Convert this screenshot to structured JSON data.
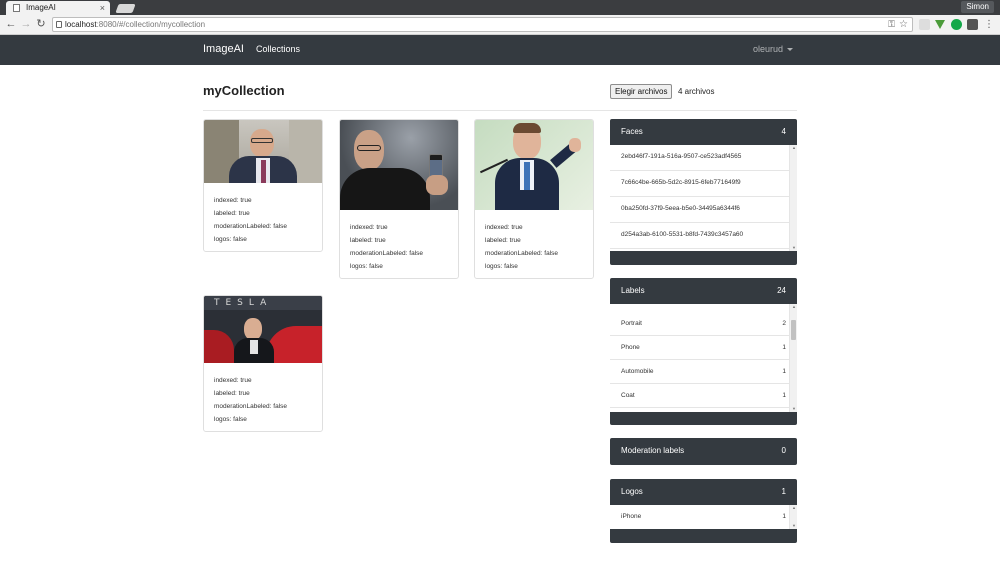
{
  "browser": {
    "tab_title": "ImageAI",
    "tab_close": "×",
    "profile": "Simon",
    "url_host": "localhost",
    "url_path": ":8080/#/collection/mycollection",
    "back": "←",
    "forward": "→",
    "reload": "↻",
    "key_glyph": "⚿",
    "star_glyph": "☆",
    "menu_glyph": "⋮"
  },
  "navbar": {
    "brand": "ImageAI",
    "collections": "Collections",
    "user": "oleurud"
  },
  "page": {
    "title": "myCollection",
    "file_button": "Elegir archivos",
    "file_status": "4 archivos"
  },
  "cards": [
    {
      "indexed": "indexed: true",
      "labeled": "labeled: true",
      "moderation": "moderationLabeled: false",
      "logos": "logos: false"
    },
    {
      "indexed": "indexed: true",
      "labeled": "labeled: true",
      "moderation": "moderationLabeled: false",
      "logos": "logos: false"
    },
    {
      "indexed": "indexed: true",
      "labeled": "labeled: true",
      "moderation": "moderationLabeled: false",
      "logos": "logos: false"
    },
    {
      "indexed": "indexed: true",
      "labeled": "labeled: true",
      "moderation": "moderationLabeled: false",
      "logos": "logos: false",
      "watermark": "TESLA"
    }
  ],
  "faces": {
    "title": "Faces",
    "count": "4",
    "items": [
      "2ebd46f7-191a-516a-9507-ce523adf4565",
      "7c66c4be-665b-5d2c-8915-6feb771649f9",
      "0ba250fd-37f9-5eea-b5e0-34495a6344f6",
      "d254a3ab-6100-5531-b8fd-7439c3457a60"
    ]
  },
  "labels": {
    "title": "Labels",
    "count": "24",
    "items": [
      {
        "name": "Portrait",
        "count": "2"
      },
      {
        "name": "Phone",
        "count": "1"
      },
      {
        "name": "Automobile",
        "count": "1"
      },
      {
        "name": "Coat",
        "count": "1"
      }
    ]
  },
  "moderation": {
    "title": "Moderation labels",
    "count": "0"
  },
  "logos": {
    "title": "Logos",
    "count": "1",
    "items": [
      {
        "name": "iPhone",
        "count": "1"
      }
    ]
  },
  "colors": {
    "navbar": "#343a40",
    "panel": "#343a40"
  }
}
